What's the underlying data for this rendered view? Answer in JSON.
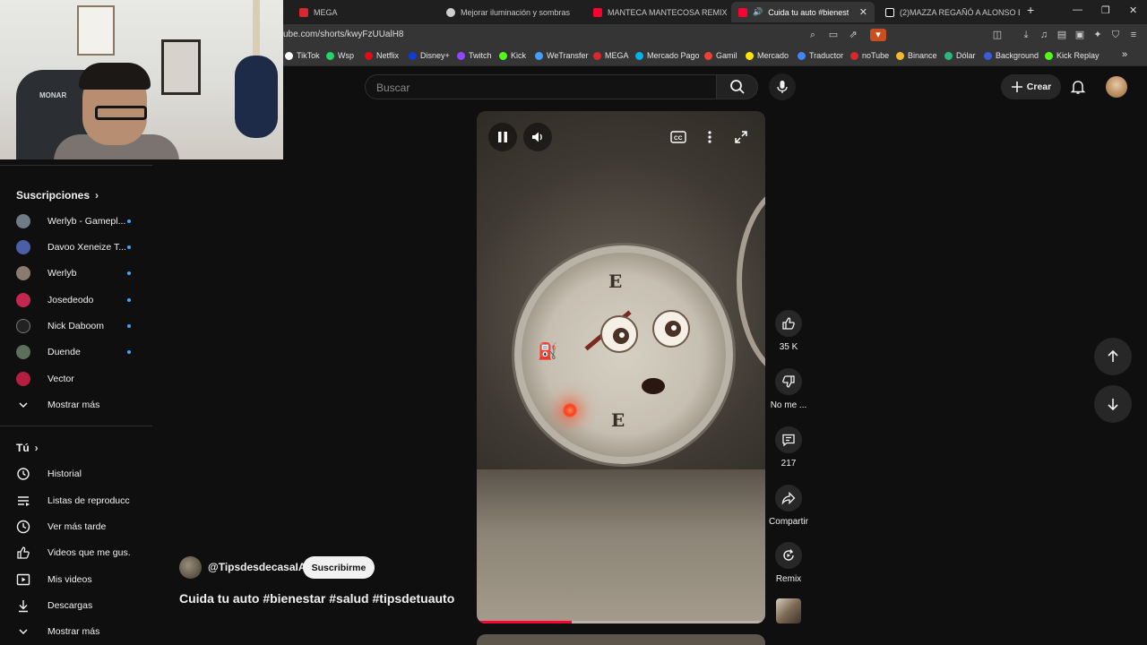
{
  "browser": {
    "tabs": [
      {
        "label": "MEGA",
        "fav": "#d9272e"
      },
      {
        "label": "Mejorar iluminación y sombras",
        "fav": "#cfcfcf"
      },
      {
        "label": "MANTECA MANTECOSA REMIX - AL",
        "fav": "#ff0033"
      },
      {
        "label": "Cuida tu auto #bienestar #sa",
        "fav": "#ff0033"
      },
      {
        "label": "(2)MAZZA REGAÑÓ A ALONSO EN",
        "fav": "#ffffff"
      }
    ],
    "new_tab": "+",
    "window_controls": [
      "—",
      "❐",
      "✕"
    ],
    "url": "ube.com/shorts/kwyFzUUalH8",
    "bookmarks": [
      {
        "label": "TikTok",
        "color": "#ffffff"
      },
      {
        "label": "Wsp",
        "color": "#25d366"
      },
      {
        "label": "Netflix",
        "color": "#e50914"
      },
      {
        "label": "Disney+",
        "color": "#113ccf"
      },
      {
        "label": "Twitch",
        "color": "#9146ff"
      },
      {
        "label": "Kick",
        "color": "#53fc18"
      },
      {
        "label": "WeTransfer",
        "color": "#409fff"
      },
      {
        "label": "MEGA",
        "color": "#d9272e"
      },
      {
        "label": "Mercado Pago",
        "color": "#00b1ea"
      },
      {
        "label": "Gamil",
        "color": "#ea4335"
      },
      {
        "label": "Mercado",
        "color": "#ffe600"
      },
      {
        "label": "Traductor",
        "color": "#4285f4"
      },
      {
        "label": "noTube",
        "color": "#d9272e"
      },
      {
        "label": "Binance",
        "color": "#f3ba2f"
      },
      {
        "label": "Dólar",
        "color": "#2db67c"
      },
      {
        "label": "Background",
        "color": "#3b5bdb"
      },
      {
        "label": "Kick Replay",
        "color": "#53fc18"
      }
    ],
    "more": "»"
  },
  "webcam": {
    "chair_logo": "MONAR"
  },
  "sidebar": {
    "subscriptions_header": "Suscripciones",
    "channels": [
      {
        "label": "Werlyb - Gamepl...",
        "color": "#6f7b86",
        "live": true
      },
      {
        "label": "Davoo Xeneize T...",
        "color": "#4b5fa8",
        "live": true
      },
      {
        "label": "Werlyb",
        "color": "#8a7b6f",
        "live": true
      },
      {
        "label": "Josedeodo",
        "color": "#c2274f",
        "live": true
      },
      {
        "label": "Nick Daboom",
        "color": "#222222",
        "live": true
      },
      {
        "label": "Duende",
        "color": "#5b6f5a",
        "live": true
      },
      {
        "label": "Vector",
        "color": "#b51f3f",
        "live": false
      }
    ],
    "show_more_1": "Mostrar más",
    "you_header": "Tú",
    "you_items": [
      {
        "label": "Historial",
        "icon": "history-icon"
      },
      {
        "label": "Listas de reproducc...",
        "icon": "playlists-icon"
      },
      {
        "label": "Ver más tarde",
        "icon": "watch-later-icon"
      },
      {
        "label": "Videos que me gus...",
        "icon": "liked-videos-icon"
      },
      {
        "label": "Mis videos",
        "icon": "my-videos-icon"
      },
      {
        "label": "Descargas",
        "icon": "downloads-icon"
      }
    ],
    "show_more_2": "Mostrar más"
  },
  "header": {
    "search_placeholder": "Buscar",
    "create_label": "Crear"
  },
  "short": {
    "channel": "@TipsdesdecasaIA",
    "subscribe_label": "Suscribirme",
    "title": "Cuida tu auto #bienestar #salud #tipsdetuauto",
    "progress": 0.33,
    "gauge_letter_top": "E",
    "gauge_letter_bottom": "E",
    "actions": {
      "likes": "35 K",
      "dislike_label": "No me ...",
      "comments": "217",
      "share_label": "Compartir",
      "remix_label": "Remix"
    }
  }
}
